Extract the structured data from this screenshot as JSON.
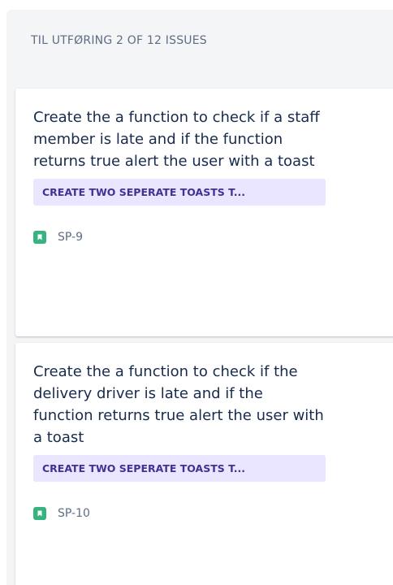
{
  "column": {
    "title": "TIL UTFØRING 2 OF 12 ISSUES"
  },
  "cards": [
    {
      "summary": "Create the a function to check if a staff member is late and if the function returns true alert the user with a toast",
      "epic": "CREATE TWO SEPERATE TOASTS T...",
      "type_icon": "story-bookmark-icon",
      "key": "SP-9"
    },
    {
      "summary": "Create the a function to check if the delivery driver is late and if the function returns true alert the user with a toast",
      "epic": "CREATE TWO SEPERATE TOASTS T...",
      "type_icon": "story-bookmark-icon",
      "key": "SP-10"
    }
  ],
  "colors": {
    "column_bg": "#f4f5f7",
    "card_bg": "#ffffff",
    "epic_bg": "#eae6ff",
    "epic_text": "#403294",
    "story_icon": "#36b37e",
    "text_primary": "#172b4d",
    "text_subtle": "#5e6c84"
  }
}
